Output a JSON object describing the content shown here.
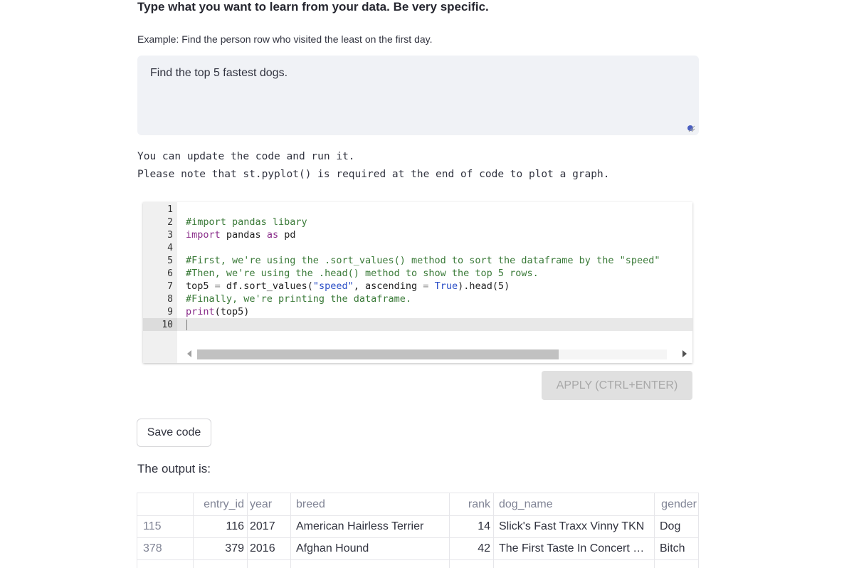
{
  "heading": "Type what you want to learn from your data. Be very specific.",
  "example_text": "Example: Find the person row who visited the least on the first day.",
  "query": {
    "value": "Find the top 5 fastest dogs."
  },
  "notes": [
    "You can update the code and run it.",
    "Please note that st.pyplot() is required at the end of code to plot a graph."
  ],
  "editor": {
    "line_numbers": [
      "1",
      "2",
      "3",
      "4",
      "5",
      "6",
      "7",
      "8",
      "9",
      "10"
    ],
    "lines": [
      "",
      "#import pandas libary",
      "import pandas as pd",
      "",
      "#First, we're using the .sort_values() method to sort the dataframe by the \"speed\"",
      "#Then, we're using the .head() method to show the top 5 rows.",
      "top5 = df.sort_values(\"speed\", ascending = True).head(5)",
      "#Finally, we're printing the dataframe.",
      "print(top5)",
      ""
    ]
  },
  "apply_button": "APPLY (CTRL+ENTER)",
  "save_button": "Save code",
  "output_label": "The output is:",
  "table": {
    "columns": [
      "",
      "entry_id",
      "year",
      "breed",
      "rank",
      "dog_name",
      "gender"
    ],
    "rows": [
      [
        "115",
        "116",
        "2017",
        "American Hairless Terrier",
        "14",
        "Slick's Fast Traxx Vinny TKN",
        "Dog"
      ],
      [
        "378",
        "379",
        "2016",
        "Afghan Hound",
        "42",
        "The First Taste In Concert …",
        "Bitch"
      ]
    ]
  },
  "colors": {
    "accent": "#4a5fc1",
    "comment": "#3a7a38",
    "keyword": "#8a2d8a",
    "string": "#2b4fc7"
  }
}
